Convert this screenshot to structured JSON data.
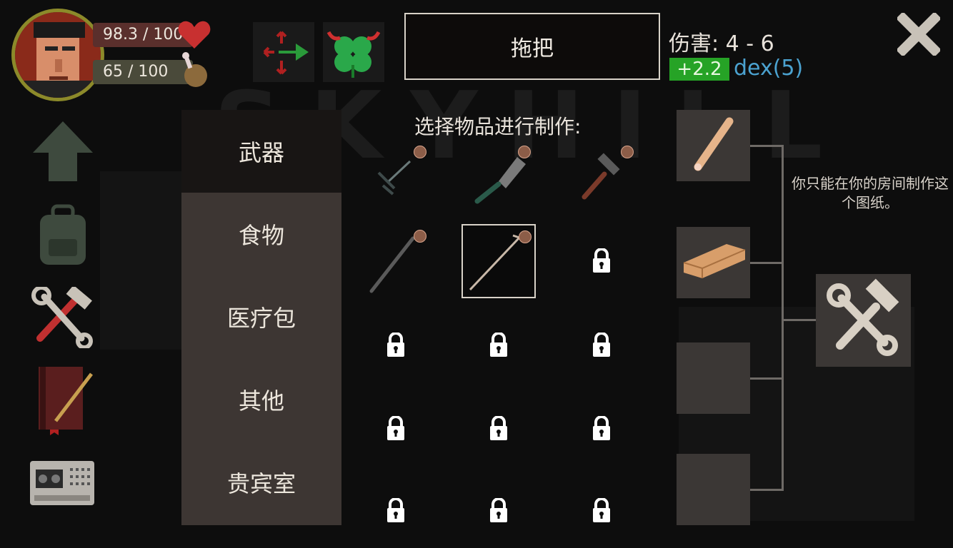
{
  "hud": {
    "health": "98.3 / 100",
    "hunger": "65 / 100",
    "health_icon": "heart-icon",
    "hunger_icon": "drumstick-icon",
    "colors": {
      "health_bar": "#5a2f2c",
      "heart": "#c83030"
    }
  },
  "item": {
    "name": "拖把",
    "damage_label": "伤害: 4 - 6",
    "bonus": "+2.2",
    "dex": "dex(5)"
  },
  "categories": [
    {
      "label": "武器",
      "active": true
    },
    {
      "label": "食物",
      "active": false
    },
    {
      "label": "医疗包",
      "active": false
    },
    {
      "label": "其他",
      "active": false
    },
    {
      "label": "贵宾室",
      "active": false
    }
  ],
  "prompt": "选择物品进行制作:",
  "hint": "你只能在你的房间制作这个图纸。",
  "grid": {
    "unlocked": [
      "sword-icon",
      "cleaver-icon",
      "hammer-icon",
      "pipe-icon",
      "mop-icon"
    ],
    "locked_count": 10,
    "selected": "mop-icon"
  },
  "ingredients": [
    "stick-icon",
    "wood-plank-icon",
    "empty-slot",
    "empty-slot"
  ],
  "colors": {
    "bonus_green": "#26a326",
    "dex_blue": "#4ba2d0",
    "panel": "#3d3633"
  }
}
